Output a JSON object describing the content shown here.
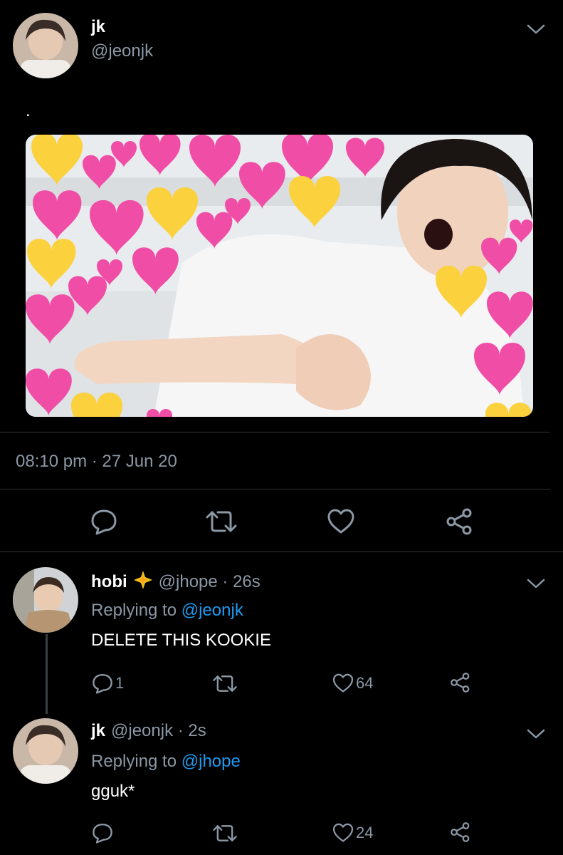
{
  "tweet": {
    "name": "jk",
    "handle": "@jeonjk",
    "text": ".",
    "timestamp": "08:10 pm · 27 Jun 20",
    "actions": {
      "reply": "reply-icon",
      "retweet": "retweet-icon",
      "like": "heart-icon",
      "share": "share-icon"
    }
  },
  "replies": [
    {
      "name": "hobi",
      "badge": "sparkle-emoji",
      "handle_time": "@jhope · 26s",
      "replying_prefix": "Replying to ",
      "replying_to": "@jeonjk",
      "text": "DELETE THIS KOOKIE",
      "reply_count": "1",
      "like_count": "64"
    },
    {
      "name": "jk",
      "handle_time": "@jeonjk · 2s",
      "replying_prefix": "Replying to ",
      "replying_to": "@jhope",
      "text": "gguk*",
      "reply_count": "",
      "like_count": "24"
    }
  ],
  "colors": {
    "background": "#000000",
    "text": "#ffffff",
    "muted": "#8b98a5",
    "link": "#1d9bf0",
    "divider": "#2f3336"
  }
}
